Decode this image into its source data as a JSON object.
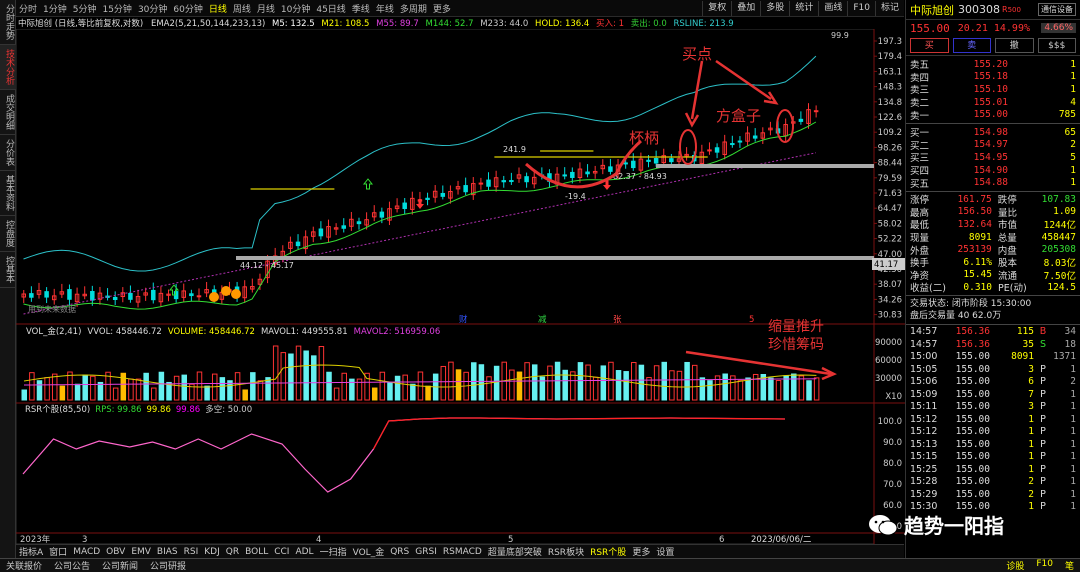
{
  "left_tabs": [
    "分时走势",
    "技术分析",
    "成交明细",
    "分价表",
    "基本资料",
    "控盘度",
    "控基本"
  ],
  "period_tabs": [
    "分时",
    "1分钟",
    "5分钟",
    "15分钟",
    "30分钟",
    "60分钟",
    "日线",
    "周线",
    "月线",
    "10分钟",
    "45日线",
    "季线",
    "年线",
    "多周期",
    "更多"
  ],
  "selected_period": "日线",
  "tools": [
    "复权",
    "叠加",
    "多股",
    "统计",
    "画线",
    "F10",
    "标记"
  ],
  "info": {
    "title": "中际旭创 (日线,等比前复权,对数)",
    "ema": "EMA2(5,21,50,144,233,13)",
    "m5": "M5: 132.5",
    "m21": "M21: 108.5",
    "m55": "M55: 89.7",
    "m144": "M144: 52.7",
    "m233": "M233: 44.0",
    "hold": "HOLD: 136.4",
    "buy": "买入: 1",
    "sell": "卖出: 0.0",
    "rsline": "RSLINE: 213.9"
  },
  "price_axis": [
    "197.3",
    "179.4",
    "163.1",
    "148.3",
    "134.8",
    "122.6",
    "109.2",
    "98.26",
    "88.44",
    "79.59",
    "71.63",
    "64.47",
    "58.02",
    "52.22",
    "47.00",
    "42.30",
    "38.07",
    "34.26",
    "30.83"
  ],
  "chart_labels": {
    "hi": "99.9",
    "val241": "241.9",
    "val8237": "82.37 - 84.93",
    "val194": "-19.4",
    "val4412": "44.12 - 45.17",
    "right4117": "41.17",
    "future": "用到未来数据",
    "a_buy": "买点",
    "a_cup": "杯柄",
    "a_box": "方盒子",
    "a_vol1": "缩量推升",
    "a_vol2": "珍惜筹码"
  },
  "markers": [
    {
      "label": "财",
      "color": "#3355ff"
    },
    {
      "label": "减",
      "color": "#2ecc40"
    },
    {
      "label": "张",
      "color": "#ff4444"
    },
    {
      "label": "5",
      "color": "#ff3333"
    }
  ],
  "vol": {
    "name": "VOL_金(2,41)",
    "vvol": "VVOL: 458446.72",
    "volume": "VOLUME: 458446.72",
    "mavol1": "MAVOL1: 449555.81",
    "mavol2": "MAVOL2: 516959.06",
    "axis": [
      "90000",
      "60000",
      "30000",
      "X10"
    ]
  },
  "rsr": {
    "name": "RSR个股(85,50)",
    "rps": "RPS: 99.86",
    "v2": "99.86",
    "v3": "99.86",
    "dk": "多空: 50.00",
    "axis": [
      "100.0",
      "90.0",
      "80.0",
      "70.0",
      "60.0",
      "50.0"
    ]
  },
  "time_axis": [
    "2023年",
    "3",
    "4",
    "5",
    "6",
    "2023/06/06/二"
  ],
  "bottom_tabs": [
    "指标A",
    "窗口",
    "MACD",
    "OBV",
    "EMV",
    "BIAS",
    "RSI",
    "KDJ",
    "QR",
    "BOLL",
    "CCI",
    "ADL",
    "一扫指",
    "VOL_金",
    "QRS",
    "GRSI",
    "RSMACD",
    "超量底部突破",
    "RSR板块",
    "RSR个股",
    "更多",
    "设置"
  ],
  "selected_bottom": "RSR个股",
  "status": [
    "关联报价",
    "公司公告",
    "公司新闻",
    "公司研报"
  ],
  "status_right": [
    "诊股",
    "F10",
    "笔"
  ],
  "rp": {
    "name": "中际旭创",
    "code": "300308",
    "tag": "R",
    "tag2": "500",
    "gear": "通信设备",
    "price": "155.00",
    "change": "20.21",
    "pct": "14.99%",
    "badge": "4.66%",
    "buttons": [
      "买",
      "卖",
      "撤",
      "$$$"
    ],
    "sells": [
      {
        "l": "卖五",
        "p": "155.20",
        "v": "1"
      },
      {
        "l": "卖四",
        "p": "155.18",
        "v": "1"
      },
      {
        "l": "卖三",
        "p": "155.10",
        "v": "1"
      },
      {
        "l": "卖二",
        "p": "155.01",
        "v": "4"
      },
      {
        "l": "卖一",
        "p": "155.00",
        "v": "785"
      }
    ],
    "buys": [
      {
        "l": "买一",
        "p": "154.98",
        "v": "65"
      },
      {
        "l": "买二",
        "p": "154.97",
        "v": "2"
      },
      {
        "l": "买三",
        "p": "154.95",
        "v": "5"
      },
      {
        "l": "买四",
        "p": "154.90",
        "v": "1"
      },
      {
        "l": "买五",
        "p": "154.88",
        "v": "1"
      }
    ],
    "stats": [
      [
        "涨停",
        "161.75",
        "跌停",
        "107.83"
      ],
      [
        "最高",
        "156.50",
        "量比",
        "1.09"
      ],
      [
        "最低",
        "132.64",
        "市值",
        "1244亿"
      ],
      [
        "现量",
        "8091",
        "总量",
        "458447"
      ],
      [
        "外盘",
        "253139",
        "内盘",
        "205308"
      ],
      [
        "换手",
        "6.11%",
        "股本",
        "8.03亿"
      ],
      [
        "净资",
        "15.45",
        "流通",
        "7.50亿"
      ],
      [
        "收益(二)",
        "0.310",
        "PE(动)",
        "124.5"
      ]
    ],
    "status_line": "交易状态: 闭市阶段 15:30:00",
    "after_line": "盘后交易量 40 62.0万",
    "ticks": [
      {
        "t": "14:57",
        "p": "156.36",
        "v": "115",
        "s": "B",
        "n": "34"
      },
      {
        "t": "14:57",
        "p": "156.36",
        "v": "35",
        "s": "S",
        "n": "18"
      },
      {
        "t": "15:00",
        "p": "155.00",
        "v": "8091",
        "s": "",
        "n": "1371"
      },
      {
        "t": "15:05",
        "p": "155.00",
        "v": "3",
        "s": "P",
        "n": "1"
      },
      {
        "t": "15:06",
        "p": "155.00",
        "v": "6",
        "s": "P",
        "n": "2"
      },
      {
        "t": "15:09",
        "p": "155.00",
        "v": "7",
        "s": "P",
        "n": "1"
      },
      {
        "t": "15:11",
        "p": "155.00",
        "v": "3",
        "s": "P",
        "n": "1"
      },
      {
        "t": "15:12",
        "p": "155.00",
        "v": "1",
        "s": "P",
        "n": "1"
      },
      {
        "t": "15:12",
        "p": "155.00",
        "v": "1",
        "s": "P",
        "n": "1"
      },
      {
        "t": "15:13",
        "p": "155.00",
        "v": "1",
        "s": "P",
        "n": "1"
      },
      {
        "t": "15:15",
        "p": "155.00",
        "v": "1",
        "s": "P",
        "n": "1"
      },
      {
        "t": "15:25",
        "p": "155.00",
        "v": "1",
        "s": "P",
        "n": "1"
      },
      {
        "t": "15:28",
        "p": "155.00",
        "v": "2",
        "s": "P",
        "n": "1"
      },
      {
        "t": "15:29",
        "p": "155.00",
        "v": "2",
        "s": "P",
        "n": "1"
      },
      {
        "t": "15:30",
        "p": "155.00",
        "v": "1",
        "s": "P",
        "n": "1"
      }
    ]
  },
  "watermark": "趋势一阳指",
  "colors": {
    "up": "#ff3333",
    "down": "#00e0e0",
    "yellow": "#ffcc00",
    "green": "#33dd33",
    "cyan": "#3cc",
    "magenta": "#e040e0",
    "annot": "#e53333"
  }
}
